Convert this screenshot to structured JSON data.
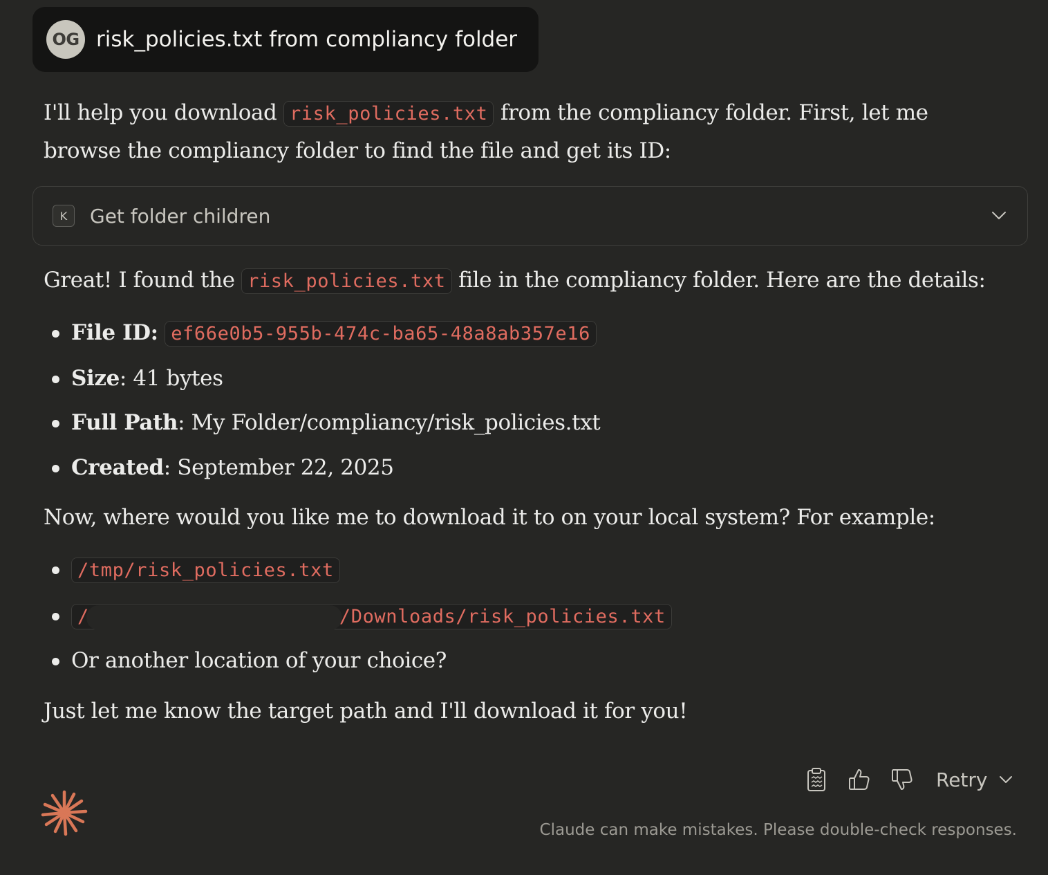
{
  "user_message": {
    "avatar_initials": "OG",
    "text": "risk_policies.txt from compliancy folder"
  },
  "response": {
    "intro": {
      "pre": "I'll help you download ",
      "code": "risk_policies.txt",
      "post_line1": " from the compliancy folder. First, let me",
      "line2": "browse the compliancy folder to find the file and get its ID:"
    },
    "tool_call": {
      "badge": "K",
      "label": "Get folder children",
      "icon": "chevron-down-icon"
    },
    "found": {
      "pre": "Great! I found the ",
      "code": "risk_policies.txt",
      "post": " file in the compliancy folder. Here are the details:"
    },
    "details": {
      "file_id_label": "File ID:",
      "file_id_value": "ef66e0b5-955b-474c-ba65-48a8ab357e16",
      "size_label": "Size",
      "size_value": ": 41 bytes",
      "path_label": "Full Path",
      "path_value": ": My Folder/compliancy/risk_policies.txt",
      "created_label": "Created",
      "created_value": ": September 22, 2025"
    },
    "question": "Now, where would you like me to download it to on your local system? For example:",
    "options": {
      "opt1": "/tmp/risk_policies.txt",
      "opt2_prefix": "/",
      "opt2_suffix": "/Downloads/risk_policies.txt",
      "opt3": "Or another location of your choice?"
    },
    "closing": "Just let me know the target path and I'll download it for you!"
  },
  "actions": {
    "copy_icon": "clipboard-icon",
    "thumbs_up_icon": "thumbs-up-icon",
    "thumbs_down_icon": "thumbs-down-icon",
    "retry_label": "Retry"
  },
  "footer": {
    "disclaimer": "Claude can make mistakes. Please double-check responses."
  },
  "colors": {
    "background": "#262624",
    "user_bubble": "#141413",
    "code_text": "#e06c60",
    "brand_spark": "#d97757"
  }
}
